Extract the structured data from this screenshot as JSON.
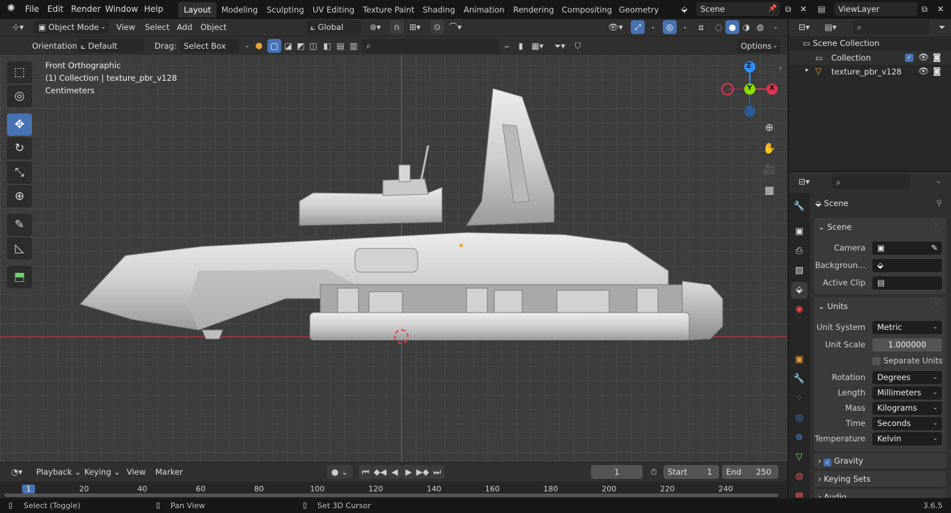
{
  "topbar": {
    "menus": [
      "File",
      "Edit",
      "Render",
      "Window",
      "Help"
    ],
    "workspaces": [
      "Layout",
      "Modeling",
      "Sculpting",
      "UV Editing",
      "Texture Paint",
      "Shading",
      "Animation",
      "Rendering",
      "Compositing",
      "Geometry Noc"
    ],
    "active_workspace": "Layout",
    "scene": "Scene",
    "view_layer": "ViewLayer"
  },
  "header": {
    "mode": "Object Mode",
    "menus": [
      "View",
      "Select",
      "Add",
      "Object"
    ],
    "transform_orientation": "Global",
    "orientation_label": "Orientation:",
    "orientation_value": "Default",
    "drag_label": "Drag:",
    "drag_value": "Select Box",
    "options": "Options"
  },
  "viewport": {
    "view_name": "Front Orthographic",
    "collection_info": "(1) Collection | texture_pbr_v128",
    "units": "Centimeters",
    "gizmo": {
      "z": "Z",
      "y": "Y",
      "x": "X"
    }
  },
  "outliner": {
    "title": "Scene Collection",
    "items": [
      {
        "label": "Collection"
      },
      {
        "label": "texture_pbr_v128"
      }
    ]
  },
  "properties": {
    "context": "Scene",
    "scene_panel": {
      "title": "Scene",
      "camera_label": "Camera",
      "background_label": "Backgroun...",
      "active_clip_label": "Active Clip"
    },
    "units_panel": {
      "title": "Units",
      "unit_system_label": "Unit System",
      "unit_system": "Metric",
      "unit_scale_label": "Unit Scale",
      "unit_scale": "1.000000",
      "separate_units": "Separate Units",
      "rotation_label": "Rotation",
      "rotation": "Degrees",
      "length_label": "Length",
      "length": "Millimeters",
      "mass_label": "Mass",
      "mass": "Kilograms",
      "time_label": "Time",
      "time": "Seconds",
      "temperature_label": "Temperature",
      "temperature": "Kelvin"
    },
    "collapsed": [
      "Gravity",
      "Keying Sets",
      "Audio"
    ]
  },
  "timeline": {
    "menus": [
      "Playback",
      "Keying",
      "View",
      "Marker"
    ],
    "current_frame": "1",
    "start_label": "Start",
    "start": "1",
    "end_label": "End",
    "end": "250",
    "ticks": [
      "1",
      "20",
      "40",
      "60",
      "80",
      "100",
      "120",
      "140",
      "160",
      "180",
      "200",
      "220",
      "240"
    ]
  },
  "statusbar": {
    "select": "Select (Toggle)",
    "pan": "Pan View",
    "cursor": "Set 3D Cursor",
    "version": "3.6.5"
  },
  "colors": {
    "accent": "#4772b3",
    "x_axis": "#e0344f",
    "y_axis": "#8bdc00",
    "z_axis": "#2c8fff"
  }
}
